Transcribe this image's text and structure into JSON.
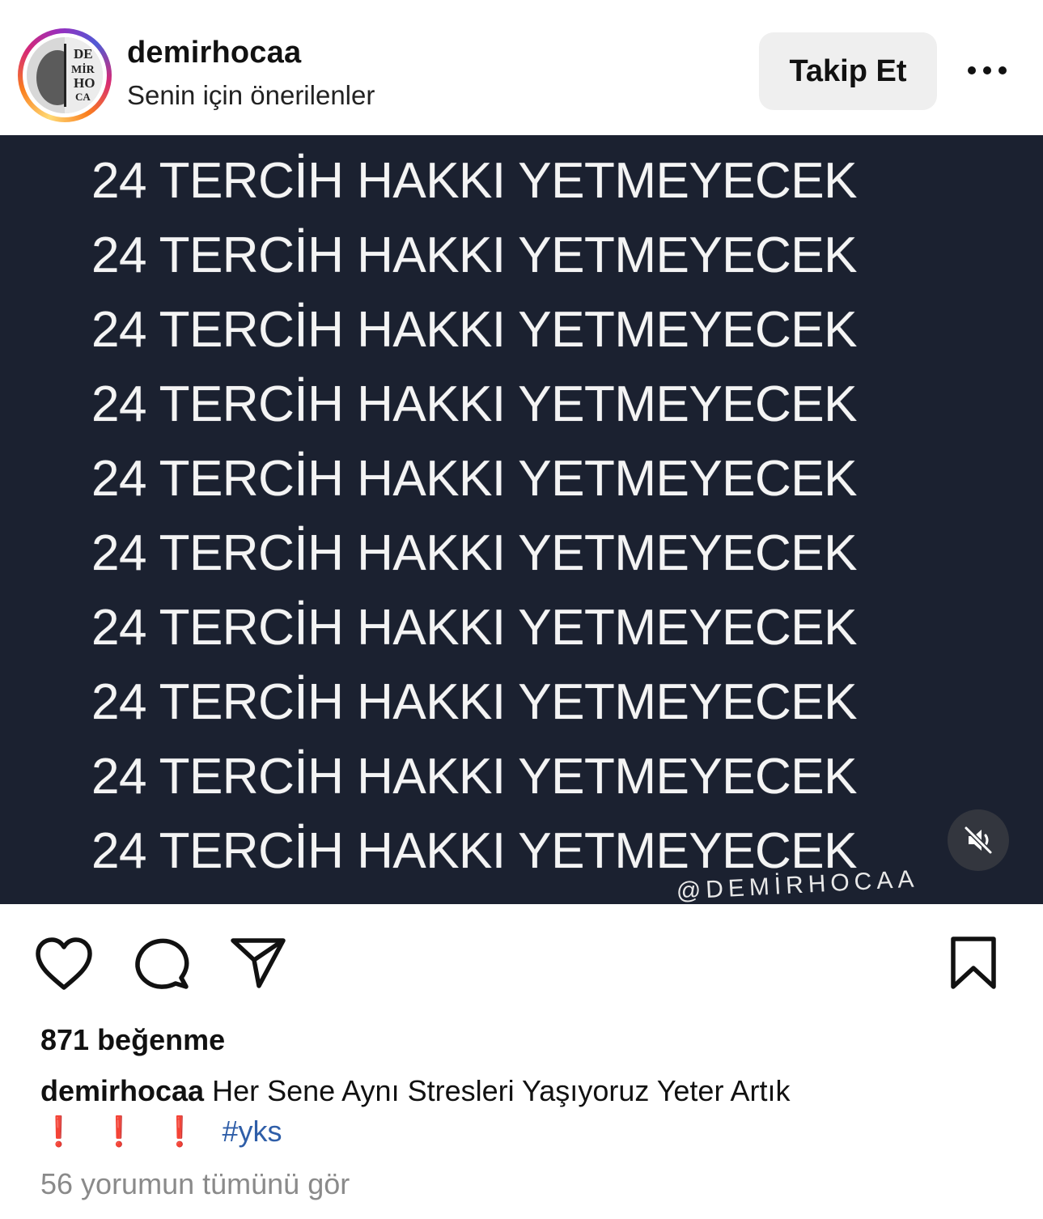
{
  "header": {
    "username": "demirhocaa",
    "subtitle": "Senin için önerilenler",
    "follow_label": "Takip Et",
    "avatar_text": [
      "DE",
      "MİR",
      "HO",
      "CA"
    ]
  },
  "media": {
    "lines": [
      "24 TERCİH HAKKI YETMEYECEK",
      "24 TERCİH HAKKI YETMEYECEK",
      "24 TERCİH HAKKI YETMEYECEK",
      "24 TERCİH HAKKI YETMEYECEK",
      "24 TERCİH HAKKI YETMEYECEK",
      "24 TERCİH HAKKI YETMEYECEK",
      "24 TERCİH HAKKI YETMEYECEK",
      "24 TERCİH HAKKI YETMEYECEK",
      "24 TERCİH HAKKI YETMEYECEK",
      "24 TERCİH HAKKI YETMEYECEK"
    ],
    "watermark": "@DEMİRHOCAA",
    "muted_icon": "speaker-muted-icon"
  },
  "actions": {
    "icons": [
      "heart-icon",
      "comment-icon",
      "share-icon",
      "bookmark-icon"
    ]
  },
  "likes": "871 beğenme",
  "caption": {
    "username": "demirhocaa",
    "text": " Her Sene Aynı Stresleri Yaşıyoruz Yeter Artık",
    "exclamations": [
      "❗",
      "❗",
      "❗"
    ],
    "hashtag": "#yks"
  },
  "comments_link": "56 yorumun tümünü gör",
  "colors": {
    "media_bg": "#1b2130",
    "hashtag": "#2f5ea8",
    "follow_bg": "#efefef"
  }
}
